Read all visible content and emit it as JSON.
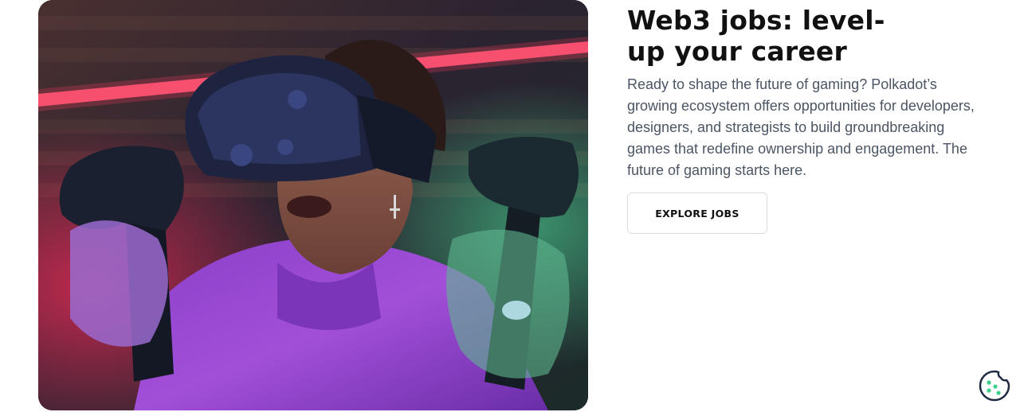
{
  "section": {
    "heading": "Web3 jobs: level-up your career",
    "body": "Ready to shape the future of gaming? Polkadot’s growing ecosystem offers opportunities for developers, designers, and strategists to build groundbreaking games that redefine ownership and engagement. The future of gaming starts here.",
    "cta_label": "EXPLORE JOBS"
  },
  "hero": {
    "icon": "vr-gamer-photo"
  },
  "cookie_widget": {
    "icon": "cookie-icon",
    "color": "#1f2a44",
    "accent": "#3ecf8e"
  }
}
